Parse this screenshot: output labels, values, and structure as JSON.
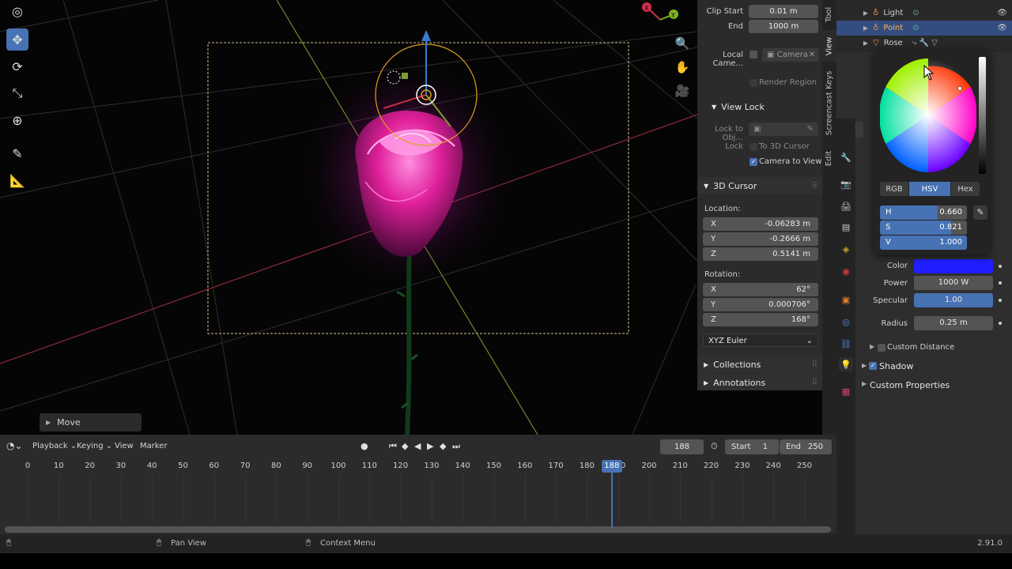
{
  "viewport": {
    "move_panel_label": "Move",
    "gizmo_axes": [
      "X",
      "Y"
    ]
  },
  "npanel": {
    "clip_start_label": "Clip Start",
    "clip_start_value": "0.01 m",
    "clip_end_label": "End",
    "clip_end_value": "1000 m",
    "local_camera_label": "Local Came...",
    "local_camera_value": "Camera",
    "render_region_label": "Render Region",
    "view_lock_header": "View Lock",
    "lock_to_object_label": "Lock to Obj...",
    "lock_label": "Lock",
    "to_3d_cursor_label": "To 3D Cursor",
    "camera_to_view_label": "Camera to View",
    "cursor_header": "3D Cursor",
    "location_label": "Location:",
    "location": [
      {
        "axis": "X",
        "value": "-0.06283 m"
      },
      {
        "axis": "Y",
        "value": "-0.2666 m"
      },
      {
        "axis": "Z",
        "value": "0.5141 m"
      }
    ],
    "rotation_label": "Rotation:",
    "rotation": [
      {
        "axis": "X",
        "value": "62°"
      },
      {
        "axis": "Y",
        "value": "0.000706°"
      },
      {
        "axis": "Z",
        "value": "168°"
      }
    ],
    "rotation_mode": "XYZ Euler",
    "collections_header": "Collections",
    "annotations_header": "Annotations"
  },
  "tabs": [
    "Tool",
    "View",
    "Screencast Keys",
    "Edit"
  ],
  "outliner": {
    "items": [
      {
        "label": "Light",
        "selected": false
      },
      {
        "label": "Point",
        "selected": true
      },
      {
        "label": "Rose",
        "selected": false
      }
    ]
  },
  "picker": {
    "modes": [
      "RGB",
      "HSV",
      "Hex"
    ],
    "active_mode": "HSV",
    "fields": [
      {
        "key": "H",
        "value": "0.660",
        "fill": 0.66
      },
      {
        "key": "S",
        "value": "0.821",
        "fill": 0.821
      },
      {
        "key": "V",
        "value": "1.000",
        "fill": 1.0
      }
    ]
  },
  "light_props": {
    "color_label": "Color",
    "color_value": "#1f1fff",
    "power_label": "Power",
    "power_value": "1000 W",
    "specular_label": "Specular",
    "specular_value": "1.00",
    "radius_label": "Radius",
    "radius_value": "0.25 m",
    "custom_distance_label": "Custom Distance",
    "shadow_label": "Shadow",
    "custom_properties_label": "Custom Properties"
  },
  "timeline": {
    "menus": [
      "Playback",
      "Keying",
      "View",
      "Marker"
    ],
    "current_frame": "188",
    "start_label": "Start",
    "start_value": "1",
    "end_label": "End",
    "end_value": "250",
    "ticks": [
      "0",
      "10",
      "20",
      "30",
      "40",
      "50",
      "60",
      "70",
      "80",
      "90",
      "100",
      "110",
      "120",
      "130",
      "140",
      "150",
      "160",
      "170",
      "180",
      "190",
      "200",
      "210",
      "220",
      "230",
      "240",
      "250"
    ],
    "playhead_frame": 188
  },
  "statusbar": {
    "pan_view": "Pan View",
    "context_menu": "Context Menu",
    "version": "2.91.0"
  },
  "colors": {
    "accent": "#4772b3",
    "rose": "#e0209a",
    "light_color": "#1f1fff"
  }
}
